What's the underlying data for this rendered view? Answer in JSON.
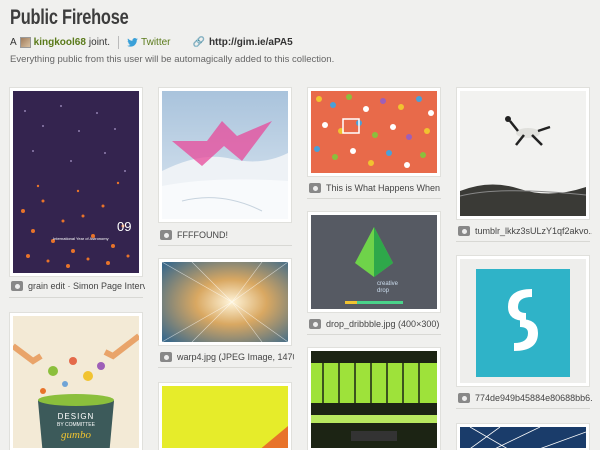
{
  "collection": {
    "title": "Public Firehose",
    "byline_prefix": "A",
    "username": "kingkool68",
    "byline_suffix": "joint.",
    "twitter_label": "Twitter",
    "short_url": "http://gim.ie/aPA5",
    "description": "Everything public from this user will be automagically added to this collection."
  },
  "items": [
    {
      "caption": "grain edit · Simon Page Interv...",
      "thumb_text": "09",
      "thumb_subtext": "International Year of Astronomy"
    },
    {
      "caption": "FFFFOUND!"
    },
    {
      "caption": "warp4.jpg (JPEG Image, 1470..."
    },
    {
      "caption": "This is What Happens When ..."
    },
    {
      "caption": "drop_dribbble.jpg (400×300)",
      "thumb_text": "creative",
      "thumb_subtext": "drop"
    },
    {
      "caption": "tumblr_lkkz3sULzY1qf2akvo..."
    },
    {
      "caption": "774de949b45884e80688bb6..."
    },
    {
      "caption": "",
      "thumb_text": "DESIGN",
      "thumb_subtext": "BY COMMITTEE",
      "thumb_word": "gumbo"
    }
  ],
  "colors": {
    "background": "#f0f0ee",
    "link_green": "#5a7a1a",
    "twitter_blue": "#3aa0d8"
  },
  "icons": [
    "camera-icon",
    "twitter-icon",
    "link-icon",
    "avatar"
  ]
}
